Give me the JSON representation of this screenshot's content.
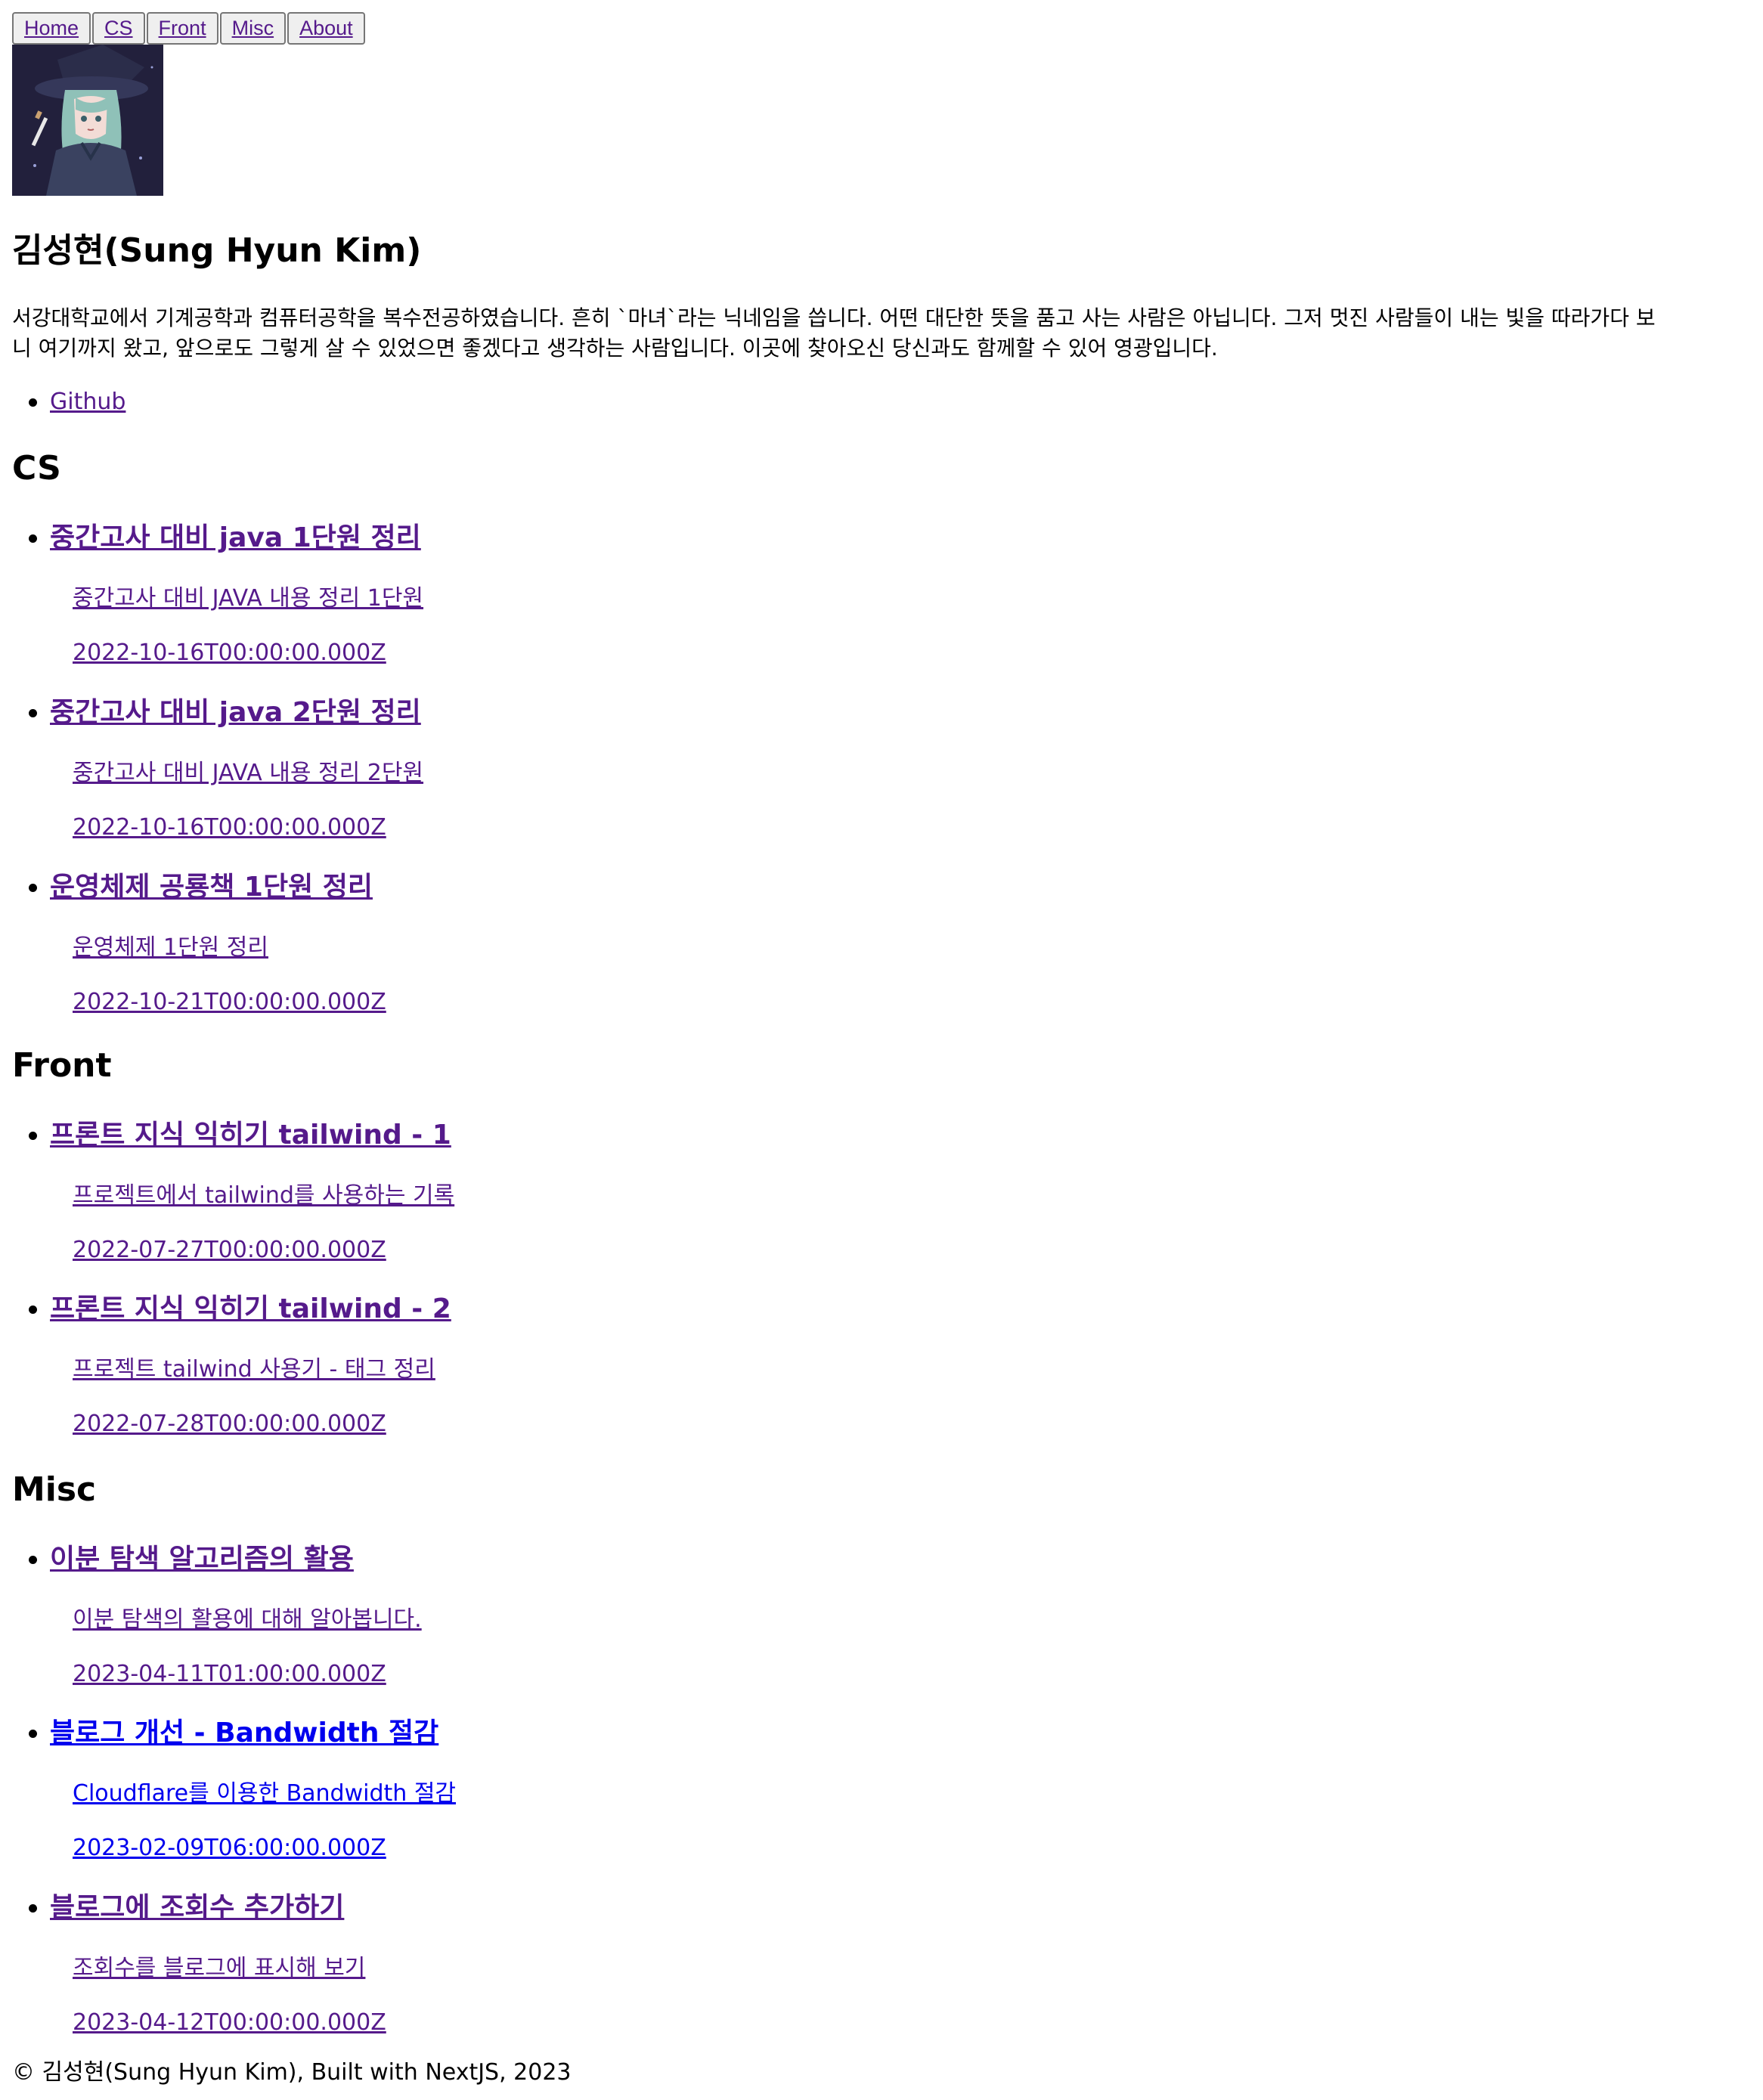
{
  "nav": {
    "items": [
      "Home",
      "CS",
      "Front",
      "Misc",
      "About"
    ]
  },
  "profile": {
    "name": "김성현(Sung Hyun Kim)",
    "bio_line1": "서강대학교에서 기계공학과 컴퓨터공학을 복수전공하였습니다. 흔히 `마녀`라는 닉네임을 씁니다. 어떤 대단한 뜻을 품고 사는 사람은 아닙니다. 그저 멋진 사람들이 내는 빛을 따라가다 보",
    "bio_line2": "니 여기까지 왔고, 앞으로도 그렇게 살 수 있었으면 좋겠다고 생각하는 사람입니다. 이곳에 찾아오신 당신과도 함께할 수 있어 영광입니다.",
    "links": [
      "Github"
    ]
  },
  "sections": {
    "cs": {
      "heading": "CS",
      "posts": [
        {
          "title": "중간고사 대비 java 1단원 정리",
          "description": "중간고사 대비 JAVA 내용 정리 1단원",
          "date": "2022-10-16T00:00:00.000Z"
        },
        {
          "title": "중간고사 대비 java 2단원 정리",
          "description": "중간고사 대비 JAVA 내용 정리 2단원",
          "date": "2022-10-16T00:00:00.000Z"
        },
        {
          "title": "운영체제 공룡책 1단원 정리",
          "description": "운영체제 1단원 정리",
          "date": "2022-10-21T00:00:00.000Z"
        }
      ]
    },
    "front": {
      "heading": "Front",
      "posts": [
        {
          "title": "프론트 지식 익히기 tailwind - 1",
          "description": "프로젝트에서 tailwind를 사용하는 기록",
          "date": "2022-07-27T00:00:00.000Z"
        },
        {
          "title": "프론트 지식 익히기 tailwind - 2",
          "description": "프로젝트 tailwind 사용기 - 태그 정리",
          "date": "2022-07-28T00:00:00.000Z"
        }
      ]
    },
    "misc": {
      "heading": "Misc",
      "posts": [
        {
          "title": "이분 탐색 알고리즘의 활용",
          "description": "이분 탐색의 활용에 대해 알아봅니다.",
          "date": "2023-04-11T01:00:00.000Z"
        },
        {
          "title": "블로그 개선 - Bandwidth 절감",
          "description": "Cloudflare를 이용한 Bandwidth 절감",
          "date": "2023-02-09T06:00:00.000Z"
        },
        {
          "title": "블로그에 조회수 추가하기",
          "description": "조회수를 블로그에 표시해 보기",
          "date": "2023-04-12T00:00:00.000Z"
        }
      ]
    }
  },
  "footer": {
    "text": "© 김성현(Sung Hyun Kim), Built with NextJS, 2023"
  },
  "colors": {
    "visited_link": "#551a8b",
    "active_link": "#0000ee",
    "button_bg": "#efefef",
    "button_border": "#767676"
  }
}
